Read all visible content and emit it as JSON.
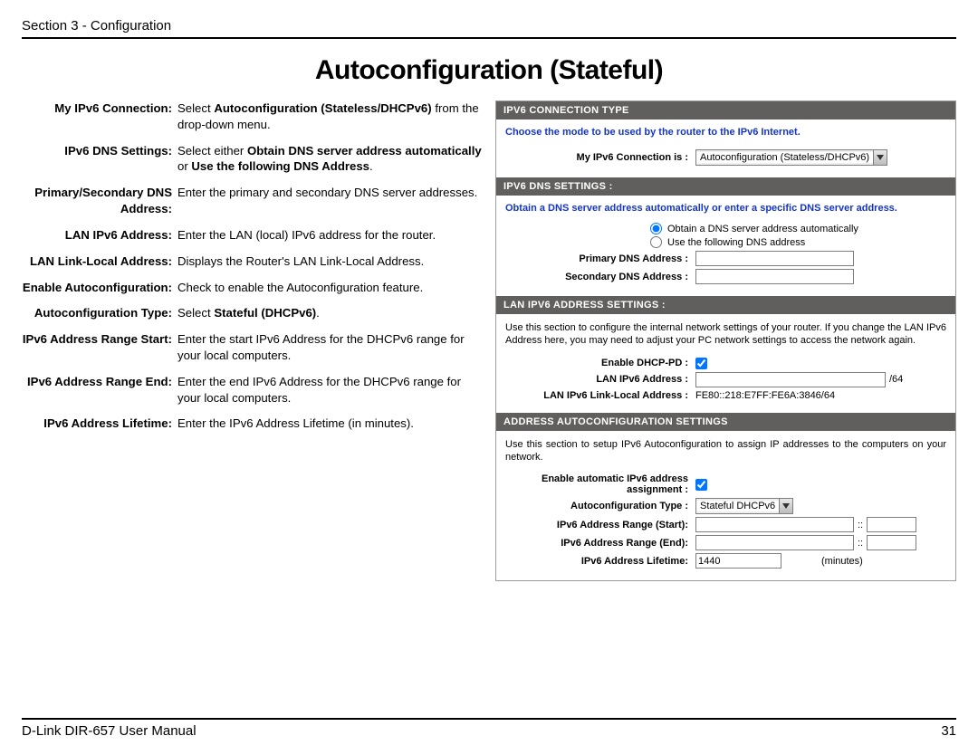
{
  "section_header": "Section 3 - Configuration",
  "title": "Autoconfiguration (Stateful)",
  "defs": [
    {
      "label": "My IPv6 Connection:",
      "val_pre": "Select ",
      "val_b1": "Autoconfiguration (Stateless/DHCPv6)",
      "val_post": " from the drop-down menu."
    },
    {
      "label": "IPv6 DNS Settings:",
      "val_pre": "Select either ",
      "val_b1": "Obtain DNS server address automatically",
      "val_mid": " or ",
      "val_b2": "Use the following DNS Address",
      "val_post": "."
    },
    {
      "label": "Primary/Secondary DNS Address:",
      "val": "Enter the primary and secondary DNS server addresses."
    },
    {
      "label": "LAN IPv6 Address:",
      "val": "Enter the LAN (local) IPv6 address for the router."
    },
    {
      "label": "LAN Link-Local Address:",
      "val": "Displays the Router's LAN Link-Local Address."
    },
    {
      "label": "Enable Autoconfiguration:",
      "val": "Check to enable the Autoconfiguration feature."
    },
    {
      "label": "Autoconfiguration Type:",
      "val_pre": "Select ",
      "val_b1": "Stateful (DHCPv6)",
      "val_post": "."
    },
    {
      "label": "IPv6 Address Range Start:",
      "val": "Enter the start IPv6 Address for the DHCPv6 range for your local computers."
    },
    {
      "label": "IPv6 Address Range End:",
      "val": "Enter the end IPv6 Address for the DHCPv6 range for your local computers."
    },
    {
      "label": "IPv6 Address Lifetime:",
      "val": "Enter the IPv6 Address Lifetime (in minutes)."
    }
  ],
  "panel": {
    "s1_head": "IPv6 CONNECTION TYPE",
    "s1_text": "Choose the mode to be used by the router to the IPv6 Internet.",
    "s1_label": "My IPv6 Connection is :",
    "s1_dd": "Autoconfiguration (Stateless/DHCPv6)",
    "s2_head": "IPv6 DNS SETTINGS :",
    "s2_text": "Obtain a DNS server address automatically or enter a specific DNS server address.",
    "s2_r1": "Obtain a DNS server address automatically",
    "s2_r2": "Use the following DNS address",
    "s2_pri": "Primary DNS Address :",
    "s2_sec": "Secondary DNS Address :",
    "s3_head": "LAN IPv6 ADDRESS SETTINGS :",
    "s3_text": "Use this section to configure the internal network settings of your router. If you change the LAN IPv6 Address here, you may need to adjust your PC network settings to access the network again.",
    "s3_pd": "Enable DHCP-PD :",
    "s3_lan": "LAN IPv6 Address :",
    "s3_lan_suffix": "/64",
    "s3_ll": "LAN IPv6 Link-Local Address :",
    "s3_ll_val": "FE80::218:E7FF:FE6A:3846/64",
    "s4_head": "ADDRESS AUTOCONFIGURATION SETTINGS",
    "s4_text": "Use this section to setup IPv6 Autoconfiguration to assign IP addresses to the computers on your network.",
    "s4_en": "Enable automatic IPv6 address assignment :",
    "s4_type": "Autoconfiguration Type :",
    "s4_type_dd": "Stateful DHCPv6",
    "s4_start": "IPv6 Address Range (Start):",
    "s4_sep": "::",
    "s4_end": "IPv6 Address Range (End):",
    "s4_life": "IPv6 Address Lifetime:",
    "s4_life_val": "1440",
    "s4_min": "(minutes)"
  },
  "footer_left": "D-Link DIR-657 User Manual",
  "footer_right": "31"
}
